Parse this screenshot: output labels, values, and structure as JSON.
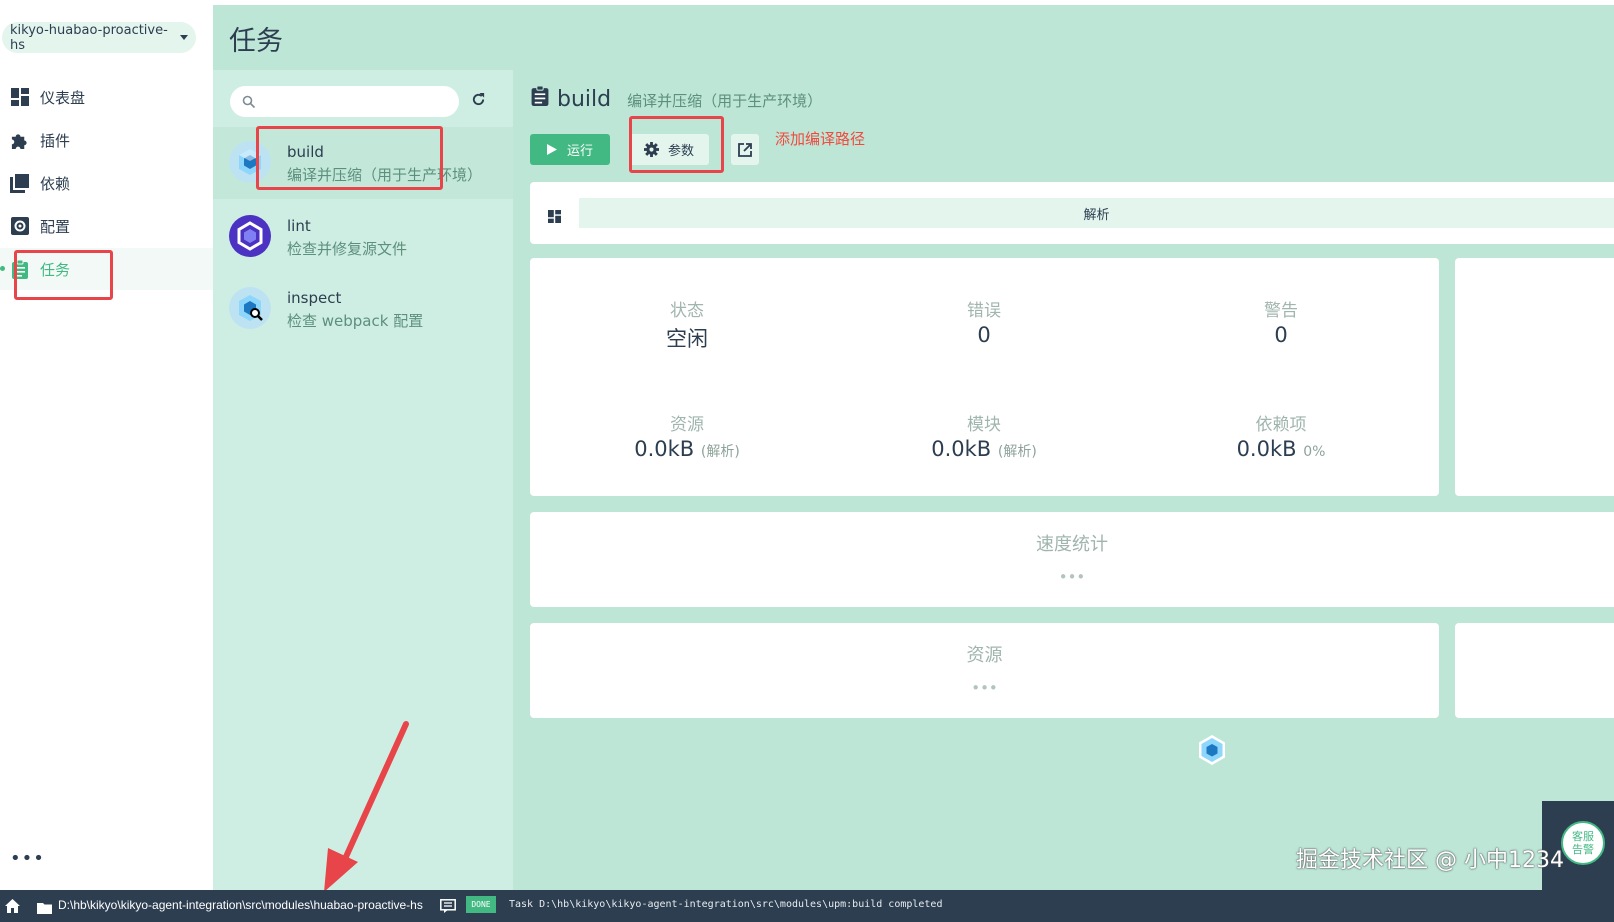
{
  "project_selector": {
    "value": "kikyo-huabao-proactive-hs"
  },
  "nav": {
    "items": [
      {
        "label": "仪表盘",
        "icon": "dashboard-icon"
      },
      {
        "label": "插件",
        "icon": "puzzle-icon"
      },
      {
        "label": "依赖",
        "icon": "library-icon"
      },
      {
        "label": "配置",
        "icon": "settings-icon"
      },
      {
        "label": "任务",
        "icon": "assignment-icon",
        "active": true
      }
    ],
    "more": "•••"
  },
  "header": {
    "title": "任务"
  },
  "tasklist": {
    "search": {
      "placeholder": ""
    },
    "tasks": [
      {
        "name": "build",
        "desc": "编译并压缩（用于生产环境）",
        "active": true
      },
      {
        "name": "lint",
        "desc": "检查并修复源文件"
      },
      {
        "name": "inspect",
        "desc": "检查 webpack 配置"
      }
    ]
  },
  "task_detail": {
    "name": "build",
    "desc": "编译并压缩（用于生产环境）",
    "run_label": "运行",
    "params_label": "参数",
    "annotation": "添加编译路径",
    "tab_label": "解析",
    "tooltip": "检查并修复源文件",
    "stats": {
      "status": {
        "label": "状态",
        "value": "空闲"
      },
      "errors": {
        "label": "错误",
        "value": "0"
      },
      "warnings": {
        "label": "警告",
        "value": "0"
      },
      "assets": {
        "label": "资源",
        "value": "0.0kB",
        "note": "(解析)"
      },
      "modules": {
        "label": "模块",
        "value": "0.0kB",
        "note": "(解析)"
      },
      "deps": {
        "label": "依赖项",
        "value": "0.0kB",
        "note": "0%"
      }
    },
    "speed_title": "速度统计",
    "assets_title": "资源",
    "placeholder_dots": "•••",
    "service_label": "客服\n告警"
  },
  "watermark": "掘金技术社区 @ 小中1234",
  "statusbar": {
    "path": "D:\\hb\\kikyo\\kikyo-agent-integration\\src\\modules\\huabao-proactive-hs",
    "badge": "DONE",
    "message": "Task D:\\hb\\kikyo\\kikyo-agent-integration\\src\\modules\\upm:build completed"
  },
  "colors": {
    "accent": "#42b983",
    "dark": "#2c3e50",
    "panel": "#bde6d7",
    "annotation": "#e8454a"
  }
}
